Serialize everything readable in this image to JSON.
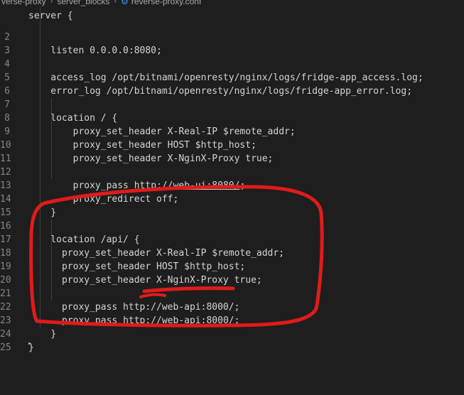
{
  "breadcrumb": {
    "items": [
      "verse-proxy",
      "server_blocks",
      "reverse-proxy.conf"
    ],
    "partial_line": "server {"
  },
  "editor": {
    "lines": [
      {
        "n": "2",
        "text": "    listen 0.0.0.0:8080;"
      },
      {
        "n": "3",
        "text": ""
      },
      {
        "n": "4",
        "text": "    access_log /opt/bitnami/openresty/nginx/logs/fridge-app_access.log;"
      },
      {
        "n": "5",
        "text": "    error_log /opt/bitnami/openresty/nginx/logs/fridge-app_error.log;"
      },
      {
        "n": "6",
        "text": ""
      },
      {
        "n": "7",
        "text": "    location / {"
      },
      {
        "n": "8",
        "text": "        proxy_set_header X-Real-IP $remote_addr;"
      },
      {
        "n": "9",
        "text": "        proxy_set_header HOST $http_host;"
      },
      {
        "n": "10",
        "text": "        proxy_set_header X-NginX-Proxy true;"
      },
      {
        "n": "11",
        "text": ""
      },
      {
        "n": "12",
        "text": "        proxy_pass http://web-ui:8080/;"
      },
      {
        "n": "13",
        "text": "        proxy_redirect off;"
      },
      {
        "n": "14",
        "text": "    }"
      },
      {
        "n": "15",
        "text": ""
      },
      {
        "n": "16",
        "text": "    location /api/ {"
      },
      {
        "n": "17",
        "text": "      proxy_set_header X-Real-IP $remote_addr;"
      },
      {
        "n": "18",
        "text": "      proxy_set_header HOST $http_host;"
      },
      {
        "n": "19",
        "text": "      proxy_set_header X-NginX-Proxy true;"
      },
      {
        "n": "20",
        "text": ""
      },
      {
        "n": "21",
        "text": "      proxy_pass http://web-api:8000/;"
      },
      {
        "n": "22",
        "text": "      proxy_redirect off;"
      },
      {
        "n": "23",
        "text": "    }"
      },
      {
        "n": "24",
        "text": "}"
      },
      {
        "n": "25",
        "text": ""
      }
    ]
  },
  "annotation": {
    "color": "#e01b1b"
  }
}
